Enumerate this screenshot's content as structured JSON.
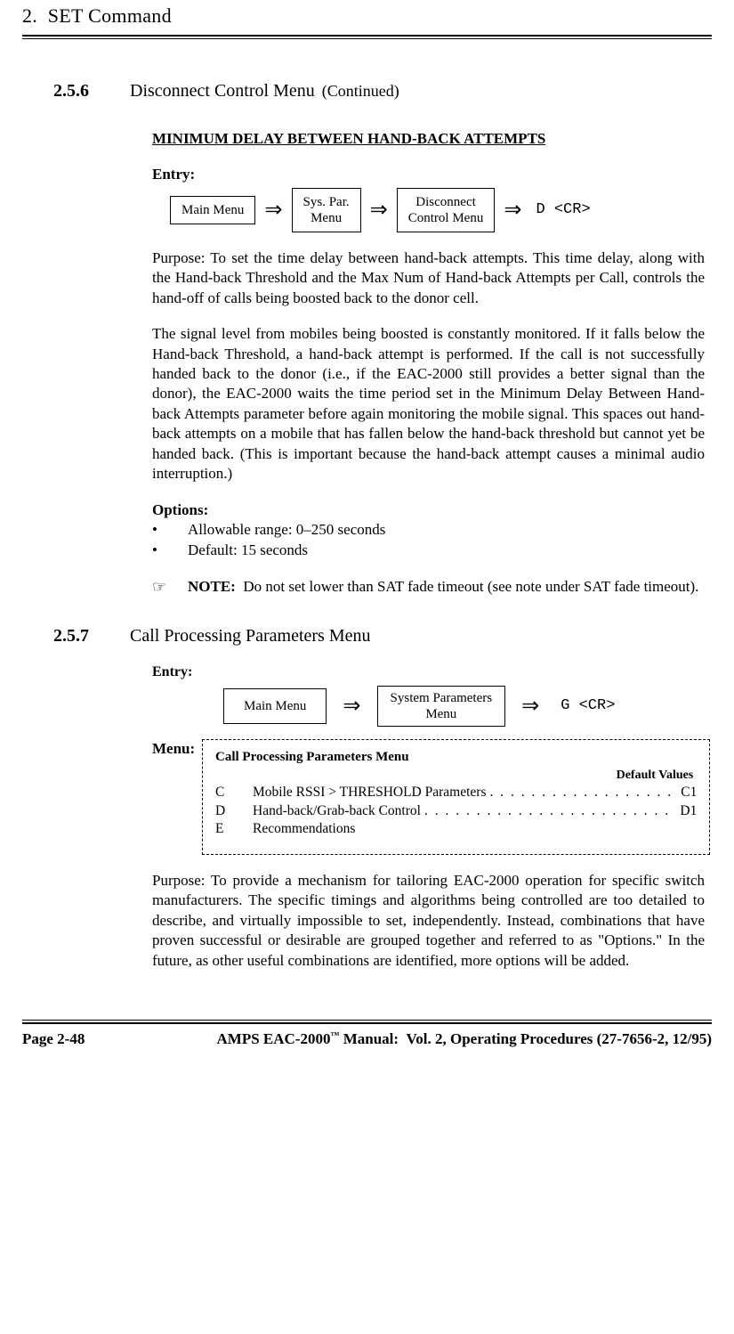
{
  "chapter": {
    "number": "2.",
    "title": "SET Command"
  },
  "sec256": {
    "number": "2.5.6",
    "title": "Disconnect Control Menu",
    "continued": "(Continued)",
    "subhead": "MINIMUM DELAY BETWEEN HAND-BACK ATTEMPTS",
    "entryLabel": "Entry:",
    "path": {
      "b1": "Main Menu",
      "b2a": "Sys. Par.",
      "b2b": "Menu",
      "b3a": "Disconnect",
      "b3b": "Control Menu",
      "cmd": "D <CR>"
    },
    "purpose": "Purpose:  To set the time delay between hand-back attempts.  This time delay, along with the Hand-back Threshold and the Max Num of Hand-back Attempts per Call, controls the hand-off of calls being boosted back to the donor cell.",
    "para2": "The signal level from mobiles being boosted is constantly monitored.  If it falls below the Hand-back Threshold, a hand-back attempt is performed.  If the call is not successfully handed back to the donor (i.e., if the EAC-2000 still provides a better signal than the donor), the EAC-2000 waits the time period set in the Minimum Delay Between Hand-back Attempts parameter before again monitoring the mobile signal.  This spaces out hand-back attempts on a mobile that has fallen below the hand-back threshold but cannot yet be handed back. (This is important because the hand-back attempt causes a minimal audio interruption.)",
    "optionsLabel": "Options:",
    "opt1": "Allowable range:   0–250 seconds",
    "opt2": "Default:   15 seconds",
    "note": "NOTE:   Do not set lower than SAT fade timeout (see note under SAT fade timeout)."
  },
  "sec257": {
    "number": "2.5.7",
    "title": "Call Processing Parameters Menu",
    "entryLabel": "Entry:",
    "path": {
      "b1": "Main Menu",
      "b2a": "System Parameters",
      "b2b": "Menu",
      "cmd": "G <CR>"
    },
    "menuLabel": "Menu:",
    "menu": {
      "title": "Call Processing Parameters Menu",
      "defvals": "Default Values",
      "items": [
        {
          "k": "C",
          "d": "Mobile RSSI > THRESHOLD Parameters",
          "v": "C1"
        },
        {
          "k": "D",
          "d": "Hand-back/Grab-back Control",
          "v": "D1"
        },
        {
          "k": "E",
          "d": "Recommendations",
          "v": ""
        }
      ]
    },
    "purpose": "Purpose:   To provide a mechanism for tailoring EAC-2000 operation for specific switch manufacturers.   The specific timings and algorithms being controlled are too detailed to describe, and virtually impossible to set, independently.  Instead, combinations that have proven successful or desirable are grouped together and referred to as \"Options.\"  In the future, as other useful combinations are identified, more options will be added."
  },
  "footer": {
    "pagenum": "Page 2-48",
    "title": "AMPS EAC-2000™ Manual:   Vol. 2, Operating Procedures (27-7656-2, 12/95)"
  }
}
